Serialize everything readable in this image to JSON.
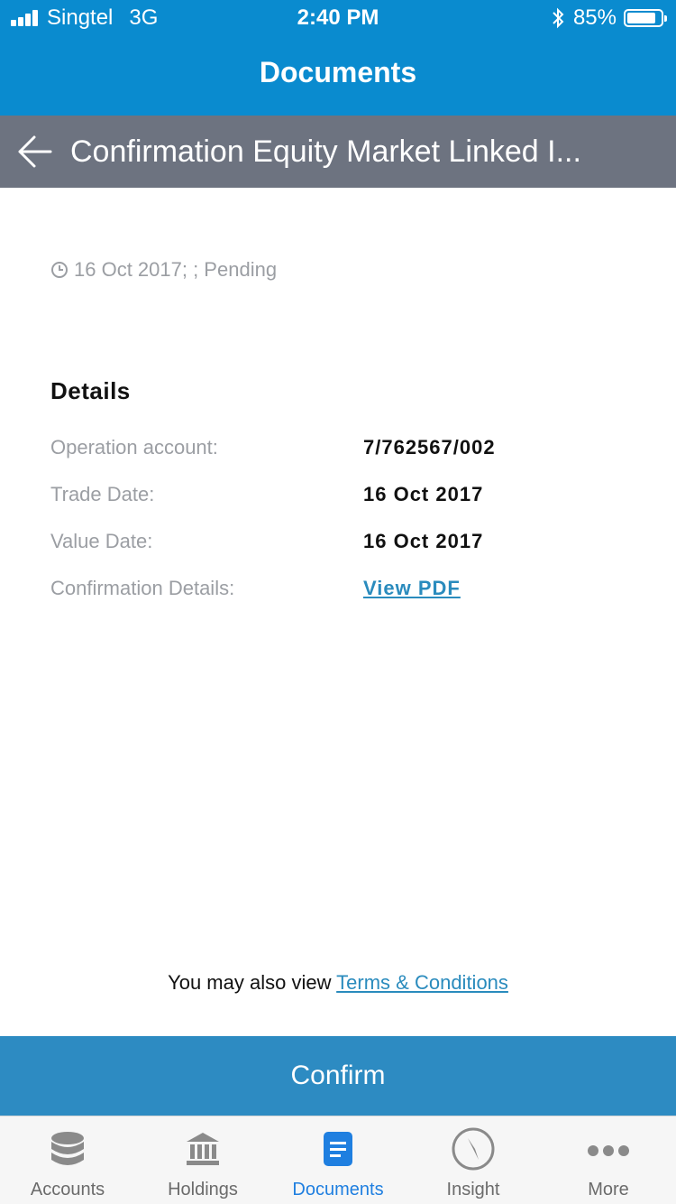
{
  "status_bar": {
    "carrier": "Singtel",
    "network": "3G",
    "time": "2:40 PM",
    "battery_percent": "85%",
    "battery_level": 0.85
  },
  "header": {
    "title": "Documents"
  },
  "subheader": {
    "title": "Confirmation Equity Market Linked I..."
  },
  "document": {
    "meta": "16 Oct 2017; ; Pending",
    "details_heading": "Details",
    "rows": [
      {
        "label": "Operation account:",
        "value": "7/762567/002"
      },
      {
        "label": "Trade Date:",
        "value": "16 Oct 2017"
      },
      {
        "label": "Value Date:",
        "value": "16 Oct 2017"
      },
      {
        "label": "Confirmation Details:",
        "value": "View PDF"
      }
    ]
  },
  "footer": {
    "terms_prefix": "You may also view ",
    "terms_link": "Terms & Conditions",
    "confirm_label": "Confirm"
  },
  "tabs": [
    {
      "label": "Accounts",
      "icon": "database-icon"
    },
    {
      "label": "Holdings",
      "icon": "bank-icon"
    },
    {
      "label": "Documents",
      "icon": "document-icon",
      "active": true
    },
    {
      "label": "Insight",
      "icon": "compass-icon"
    },
    {
      "label": "More",
      "icon": "more-icon"
    }
  ],
  "colors": {
    "primary_blue": "#0a8bcf",
    "subheader_gray": "#6d7380",
    "confirm_blue": "#2d8bc2",
    "link_blue": "#2a8bbd",
    "active_tab_blue": "#1f7fe0"
  }
}
